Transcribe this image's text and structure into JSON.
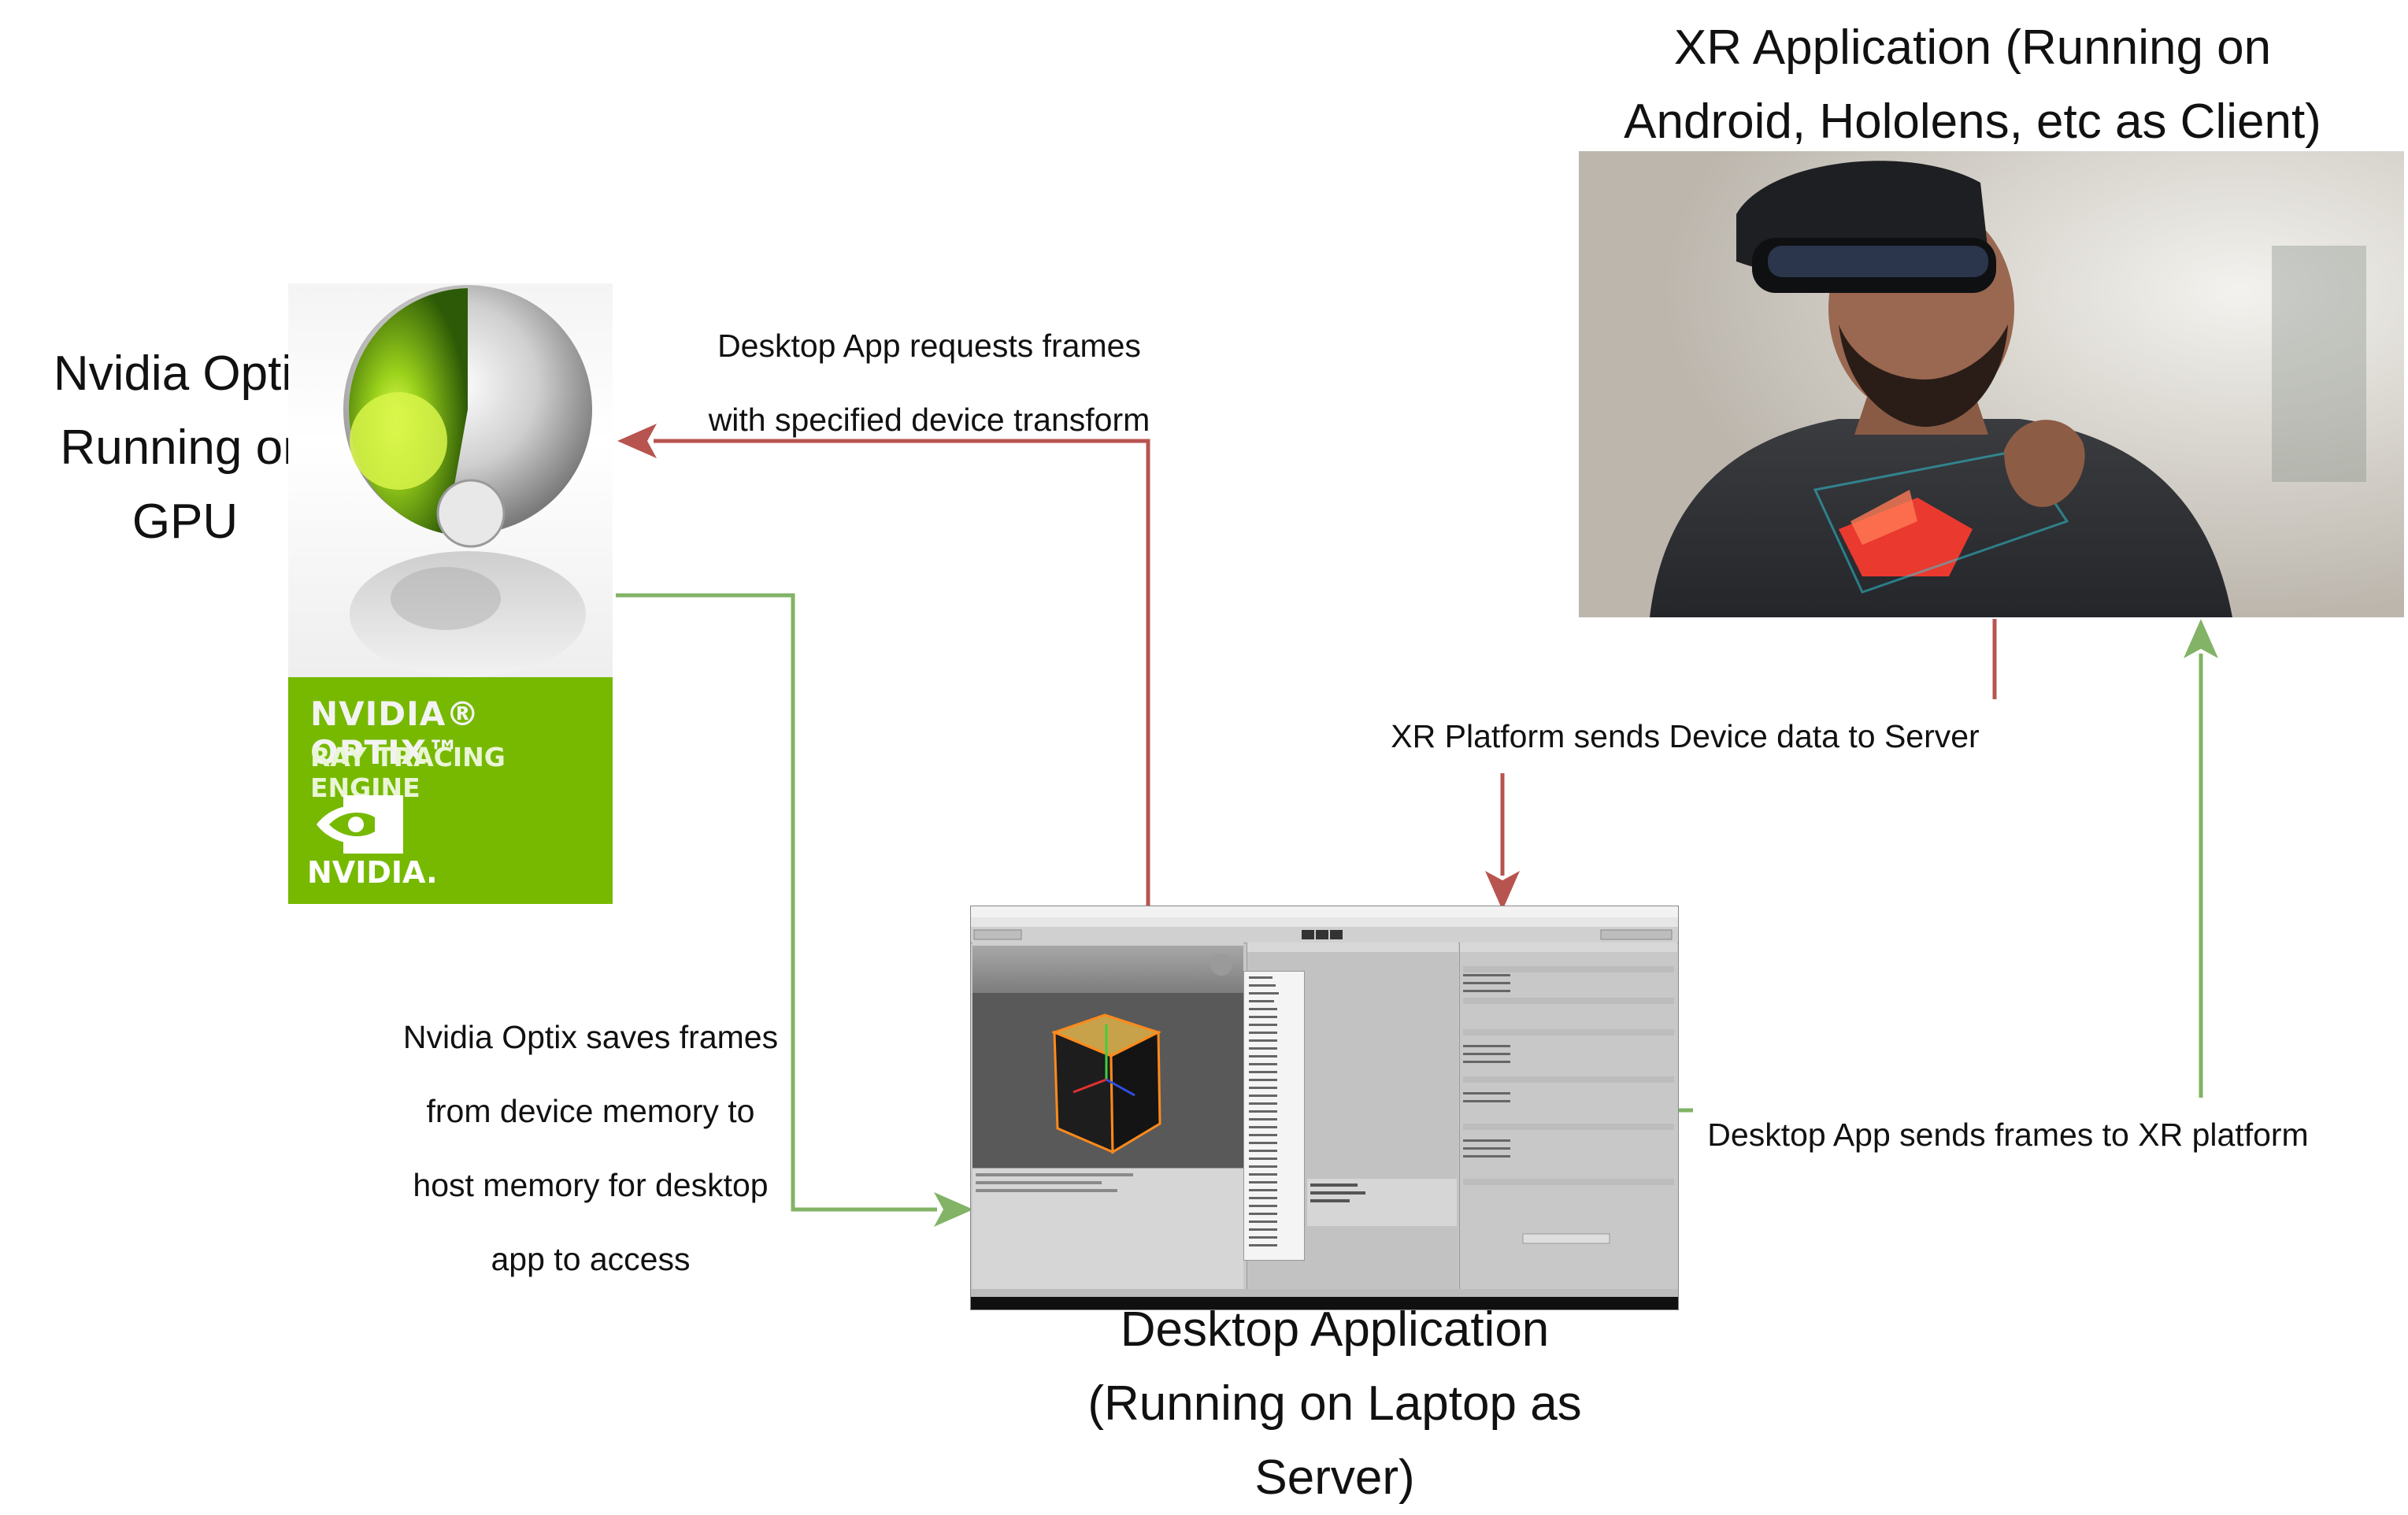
{
  "nodes": {
    "optix": {
      "title_lines": [
        "Nvidia Optix",
        "Running on",
        "GPU"
      ],
      "logo": {
        "brand": "NVIDIA® OPTIX™",
        "subtitle": "RAY TRACING ENGINE",
        "wordmark": "NVIDIA."
      }
    },
    "xr": {
      "title_lines": [
        "XR Application (Running on",
        "Android, Hololens, etc as Client)"
      ]
    },
    "desktop": {
      "title_lines": [
        "Desktop Application",
        "(Running on Laptop as",
        "Server)"
      ]
    }
  },
  "edges": {
    "desktop_to_optix": {
      "lines": [
        "Desktop App requests frames",
        "with specified device transform"
      ],
      "color": "#b85450"
    },
    "optix_to_desktop": {
      "lines": [
        "Nvidia Optix saves frames",
        "from device memory to",
        "host memory for desktop",
        "app to access"
      ],
      "color": "#82b366"
    },
    "xr_to_desktop": {
      "lines": [
        "XR Platform sends Device data to Server"
      ],
      "color": "#b85450"
    },
    "desktop_to_xr": {
      "lines": [
        "Desktop App sends frames to XR platform"
      ],
      "color": "#82b366"
    }
  },
  "colors": {
    "red_arrow": "#b85450",
    "green_arrow": "#82b366",
    "nvidia_green": "#76b900"
  }
}
